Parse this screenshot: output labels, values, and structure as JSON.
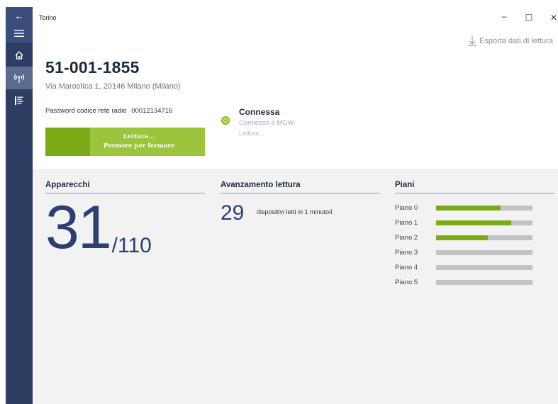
{
  "window": {
    "title": "Torino",
    "back_icon": "←",
    "minimize": "–",
    "maximize": "☐",
    "close": "✕"
  },
  "export": {
    "label": "Esporta dati di lettura",
    "icon": "download-icon"
  },
  "device": {
    "id": "51-001-1855",
    "address": "Via Marostica 1, 20146 Milano (Milano)",
    "password_label": "Password codice rete radio",
    "password_value": "00012134716"
  },
  "read_button": {
    "line1": "Lettura...",
    "line2": "Premere per fermare",
    "progress": 0.28
  },
  "connection": {
    "status": "Connessa",
    "detail": "Connesso a MGW",
    "state": "Lettura..."
  },
  "sections": {
    "devices": {
      "title": "Apparecchi",
      "count": "31",
      "total": "/110"
    },
    "progress": {
      "title": "Avanzamento lettura",
      "rate": "29",
      "rate_text": "dispositivi letti in 1 minuto/i"
    },
    "floors": {
      "title": "Piani",
      "items": [
        {
          "label": "Piano 0",
          "fraction": 0.67
        },
        {
          "label": "Piano 1",
          "fraction": 0.78
        },
        {
          "label": "Piano 2",
          "fraction": 0.54
        },
        {
          "label": "Piano 3",
          "fraction": 0
        },
        {
          "label": "Piano 4",
          "fraction": 0
        },
        {
          "label": "Piano 5",
          "fraction": 0
        }
      ]
    }
  },
  "colors": {
    "accent_green": "#7aab16",
    "light_green": "#9bc53d",
    "sidebar": "#2e3d63",
    "navy_text": "#2c3f73"
  }
}
